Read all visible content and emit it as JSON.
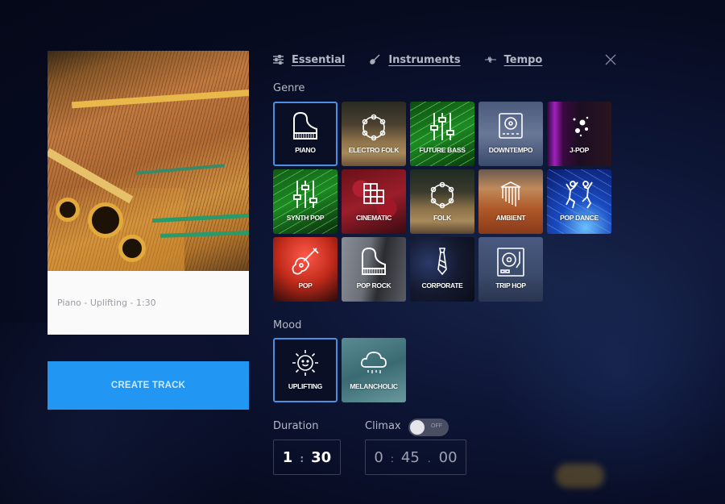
{
  "preview": {
    "caption": "Piano - Uplifting - 1:30"
  },
  "create_button": {
    "label": "CREATE TRACK"
  },
  "tabs": [
    {
      "label": "Essential",
      "icon": "sliders-icon"
    },
    {
      "label": "Instruments",
      "icon": "guitar-icon"
    },
    {
      "label": "Tempo",
      "icon": "waveform-icon"
    }
  ],
  "close": {
    "icon": "close-icon"
  },
  "genre": {
    "label": "Genre",
    "selected": "PIANO",
    "items": [
      {
        "label": "PIANO",
        "icon": "piano-icon"
      },
      {
        "label": "ELECTRO FOLK",
        "icon": "tambourine-icon"
      },
      {
        "label": "FUTURE BASS",
        "icon": "mixer-sliders-icon"
      },
      {
        "label": "DOWNTEMPO",
        "icon": "turntable-icon"
      },
      {
        "label": "J-POP",
        "icon": "sparkles-icon"
      },
      {
        "label": "SYNTH POP",
        "icon": "mixer-sliders-icon"
      },
      {
        "label": "CINEMATIC",
        "icon": "command-knot-icon"
      },
      {
        "label": "FOLK",
        "icon": "tambourine-icon"
      },
      {
        "label": "AMBIENT",
        "icon": "pan-flute-icon"
      },
      {
        "label": "POP DANCE",
        "icon": "dancers-icon"
      },
      {
        "label": "POP",
        "icon": "guitar-icon"
      },
      {
        "label": "POP ROCK",
        "icon": "piano-icon"
      },
      {
        "label": "CORPORATE",
        "icon": "tie-icon"
      },
      {
        "label": "TRIP HOP",
        "icon": "turntable-icon"
      }
    ]
  },
  "mood": {
    "label": "Mood",
    "selected": "UPLIFTING",
    "items": [
      {
        "label": "UPLIFTING",
        "icon": "smiling-sun-icon"
      },
      {
        "label": "MELANCHOLIC",
        "icon": "rain-cloud-icon"
      }
    ]
  },
  "duration": {
    "label": "Duration",
    "minutes": "1",
    "seconds": "30"
  },
  "climax": {
    "label": "Climax",
    "toggle_state": "OFF",
    "enabled": false,
    "minutes": "0",
    "seconds": "45",
    "hundredths": "00"
  },
  "colors": {
    "accent": "#2196f3",
    "selected_border": "#4a8fe0",
    "background": "#070b20"
  }
}
